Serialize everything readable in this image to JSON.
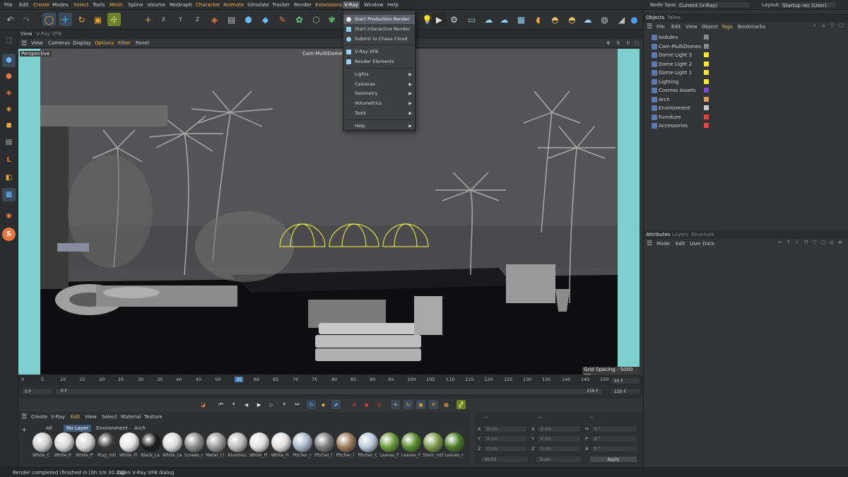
{
  "menubar": {
    "items": [
      "File",
      "Edit",
      "Create",
      "Modes",
      "Select",
      "Tools",
      "Mesh",
      "Spline",
      "Volume",
      "MoGraph",
      "Character",
      "Animate",
      "Simulate",
      "Tracker",
      "Render",
      "Extensions",
      "V-Ray",
      "Window",
      "Help"
    ],
    "node_space_label": "Node Space:",
    "node_space_value": "Current (V-Ray)",
    "layout_label": "Layout:",
    "layout_value": "Startup rec (User)"
  },
  "vray_menu": {
    "items": [
      {
        "label": "Start Production Render",
        "icon": "render-icon",
        "selected": true
      },
      {
        "label": "Start Interactive Render",
        "icon": "interactive-render-icon"
      },
      {
        "label": "Submit to Chaos Cloud",
        "icon": "cloud-icon"
      },
      {
        "label": "V-Ray VFB",
        "icon": "vfb-icon"
      },
      {
        "label": "Render Elements",
        "icon": "render-elements-icon"
      },
      {
        "label": "Lights",
        "submenu": true
      },
      {
        "label": "Cameras",
        "submenu": true
      },
      {
        "label": "Geometry",
        "submenu": true
      },
      {
        "label": "Volumetrics",
        "submenu": true
      },
      {
        "label": "Tools",
        "submenu": true
      },
      {
        "label": "Help",
        "submenu": true
      }
    ]
  },
  "view_tabs": {
    "tab1": "View",
    "tab2": "V-Ray VFB"
  },
  "viewport_menu": {
    "items": [
      "View",
      "Cameras",
      "Display",
      "Options",
      "Filter",
      "Panel"
    ]
  },
  "viewport": {
    "mode": "Perspective",
    "camera": "Cam-MultiDomes",
    "grid_spacing": "Grid Spacing : 5000 cm"
  },
  "timeline": {
    "ticks": [
      "0",
      "5",
      "10",
      "15",
      "20",
      "25",
      "30",
      "35",
      "40",
      "45",
      "50",
      "55",
      "60",
      "65",
      "70",
      "75",
      "80",
      "85",
      "90",
      "95",
      "100",
      "105",
      "110",
      "115",
      "120",
      "125",
      "130",
      "135",
      "140",
      "145",
      "150"
    ],
    "current_frame": "35",
    "start": "0 F",
    "start2": "0 F",
    "end": "150 F",
    "end2": "150 F",
    "end_field": "55 F",
    "end_field2": "150 F"
  },
  "objects_panel": {
    "tabs": [
      "Objects",
      "Takes"
    ],
    "menu": [
      "File",
      "Edit",
      "View",
      "Object",
      "Tags",
      "Bookmarks"
    ],
    "rows": [
      {
        "name": "lookdev",
        "color": "#8a8a8a"
      },
      {
        "name": "Cam-MultiDomes",
        "color": "#8a8a8a"
      },
      {
        "name": "Dome Light 3",
        "color": "#f5e43a"
      },
      {
        "name": "Dome Light 2",
        "color": "#f5e43a"
      },
      {
        "name": "Dome Light 1",
        "color": "#f5e43a"
      },
      {
        "name": "Lighting",
        "color": "#f5e43a"
      },
      {
        "name": "Cosmos Assets",
        "color": "#7a48c8"
      },
      {
        "name": "Arch",
        "color": "#d89a66"
      },
      {
        "name": "Environment",
        "color": "#c9c9c9"
      },
      {
        "name": "Furniture",
        "color": "#e04848"
      },
      {
        "name": "Accessories",
        "color": "#e04848"
      }
    ]
  },
  "attributes_panel": {
    "tabs": [
      "Attributes",
      "Layers",
      "Structure"
    ],
    "menu": [
      "Mode",
      "Edit",
      "User Data"
    ]
  },
  "material_manager": {
    "menu": [
      "Create",
      "V-Ray",
      "Edit",
      "View",
      "Select",
      "Material",
      "Texture"
    ],
    "filters": [
      "All",
      "No Layer",
      "Environment",
      "Arch"
    ],
    "materials": [
      "White_C",
      "White_P",
      "White_P",
      "Plug_mtl",
      "White_Fi",
      "Black_La",
      "White_Le",
      "Screws_r",
      "Metal_Cl",
      "Aluminiu",
      "White_Fi",
      "White_Fi",
      "Pitcher_r",
      "Pitcher_l",
      "Pitcher_l",
      "Pitcher_C",
      "Leaves_F",
      "Leaves_F",
      "Stem_mtl",
      "Leaves_r"
    ]
  },
  "coordinates": {
    "x_label": "X",
    "y_label": "Y",
    "z_label": "Z",
    "h_label": "H",
    "p_label": "P",
    "b_label": "B",
    "value": "0 cm",
    "angle": "0 °",
    "world": "World",
    "scale": "Scale",
    "apply": "Apply",
    "dash": "--"
  },
  "status": {
    "text": "Render completed (finished in [0h  1m 30.2s])",
    "hint": "Open V-Ray VFB dialog"
  }
}
